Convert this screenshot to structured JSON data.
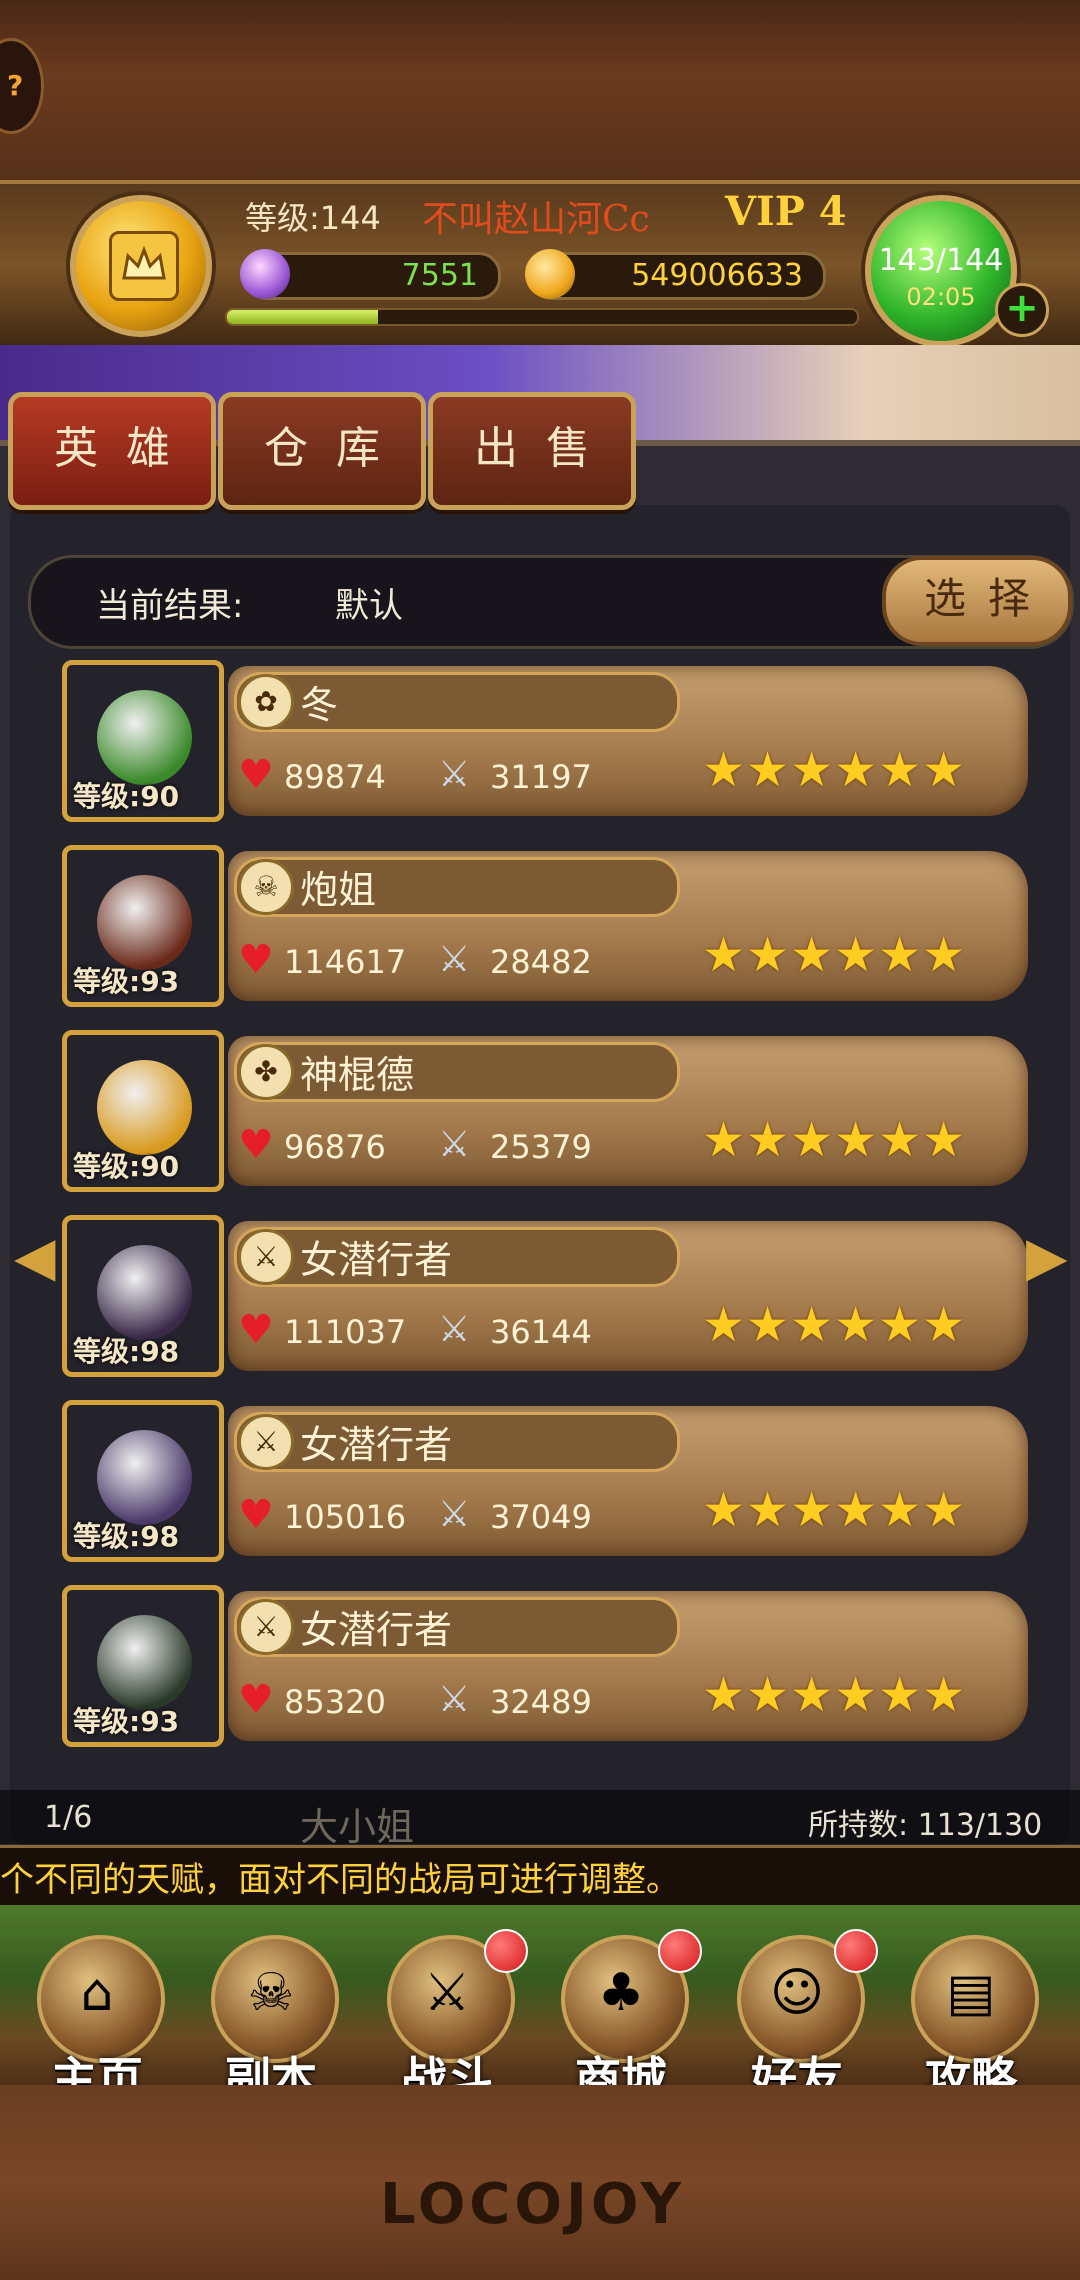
{
  "header": {
    "level_text": "等级:144",
    "player_name": "不叫赵山河Cc",
    "vip": "VIP 4",
    "gems": "7551",
    "gold": "549006633",
    "energy": "143/144",
    "energy_timer": "02:05",
    "exp_progress": 0.24,
    "plus_label": "+"
  },
  "tabs": [
    {
      "label": "英雄",
      "active": true
    },
    {
      "label": "仓库",
      "active": false
    },
    {
      "label": "出售",
      "active": false
    }
  ],
  "filter": {
    "label": "当前结果:",
    "value": "默认",
    "select_label": "选择"
  },
  "heroes": [
    {
      "name": "冬",
      "level": "等级:90",
      "hp": "89874",
      "attack": "31197",
      "stars": 6,
      "class_icon": "nature-icon",
      "color": "#3a8a2a"
    },
    {
      "name": "炮姐",
      "level": "等级:93",
      "hp": "114617",
      "attack": "28482",
      "stars": 6,
      "class_icon": "skull-icon",
      "color": "#6a2a1a"
    },
    {
      "name": "神棍德",
      "level": "等级:90",
      "hp": "96876",
      "attack": "25379",
      "stars": 6,
      "class_icon": "paw-icon",
      "color": "#d89a1e"
    },
    {
      "name": "女潜行者",
      "level": "等级:98",
      "hp": "111037",
      "attack": "36144",
      "stars": 6,
      "class_icon": "swords-icon",
      "color": "#3a2a4a"
    },
    {
      "name": "女潜行者",
      "level": "等级:98",
      "hp": "105016",
      "attack": "37049",
      "stars": 6,
      "class_icon": "swords-icon",
      "color": "#4a3a6a"
    },
    {
      "name": "女潜行者",
      "level": "等级:93",
      "hp": "85320",
      "attack": "32489",
      "stars": 6,
      "class_icon": "swords-icon",
      "color": "#2a3a2a"
    }
  ],
  "partial_hero_name": "大小姐",
  "pagination": {
    "page": "1/6",
    "owned": "所持数: 113/130"
  },
  "ticker": "个不同的天赋，面对不同的战局可进行调整。",
  "nav": [
    {
      "label": "主页",
      "icon": "house-icon",
      "badge": false
    },
    {
      "label": "副本",
      "icon": "skull-icon",
      "badge": false
    },
    {
      "label": "战斗",
      "icon": "sword-icon",
      "badge": true
    },
    {
      "label": "商城",
      "icon": "shop-monster-icon",
      "badge": true
    },
    {
      "label": "好友",
      "icon": "friends-icon",
      "badge": true
    },
    {
      "label": "攻略",
      "icon": "book-icon",
      "badge": false
    }
  ],
  "logo": "LOCOJOY",
  "corner_symbol": "?"
}
